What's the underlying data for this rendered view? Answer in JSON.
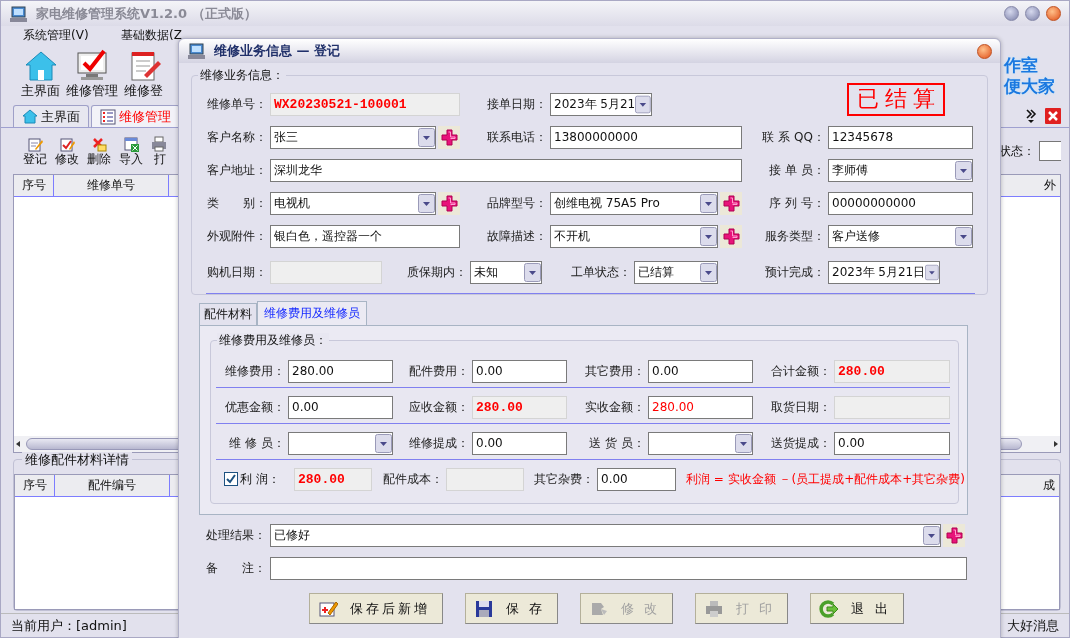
{
  "app": {
    "title": "家电维修管理系统V1.2.0 （正式版）",
    "menu": [
      "系统管理(V)",
      "基础数据(Z"
    ],
    "toolbar": [
      "主界面",
      "维修管理",
      "维修登"
    ],
    "banner": [
      "作室",
      "便大家"
    ],
    "tabs": [
      {
        "label": "主界面",
        "selected": false
      },
      {
        "label": "维修管理",
        "selected": true
      }
    ],
    "actions": [
      "登记",
      "修改",
      "删除",
      "导入",
      "打"
    ],
    "status_filter": {
      "label": "状态："
    },
    "orders_table": {
      "columns": [
        "序号",
        "维修单号",
        "外"
      ]
    },
    "parts_panel": {
      "title": "维修配件材料详情",
      "columns": [
        "序号",
        "配件编号",
        "成"
      ]
    },
    "status_bar": {
      "user": "当前用户：[admin]",
      "message": "大好消息"
    }
  },
  "dialog": {
    "title": "维修业务信息 — 登记",
    "info": {
      "title": "维修业务信息：",
      "stamp": "已结算",
      "fields": [
        {
          "label": "维修单号：",
          "kind": "amount",
          "value": "WX20230521-100001"
        },
        {
          "label": "接单日期：",
          "kind": "date",
          "value": "2023年 5月21"
        },
        {
          "label": "客户名称：",
          "kind": "combo",
          "value": "张三",
          "plus": true
        },
        {
          "label": "联系电话：",
          "kind": "text",
          "value": "13800000000"
        },
        {
          "label": "联 系 QQ：",
          "kind": "text",
          "value": "12345678"
        },
        {
          "label": "客户地址：",
          "kind": "text",
          "value": "深圳龙华"
        },
        {
          "label": "接 单 员：",
          "kind": "combo",
          "value": "李师傅"
        },
        {
          "label": "类　　别：",
          "kind": "combo",
          "value": "电视机",
          "plus": true
        },
        {
          "label": "品牌型号：",
          "kind": "combo",
          "value": "创维电视 75A5 Pro",
          "plus": true
        },
        {
          "label": "序 列 号：",
          "kind": "text",
          "value": "00000000000"
        },
        {
          "label": "外观附件：",
          "kind": "text",
          "value": "银白色，遥控器一个"
        },
        {
          "label": "故障描述：",
          "kind": "combo",
          "value": "不开机",
          "plus": true
        },
        {
          "label": "服务类型：",
          "kind": "combo",
          "value": "客户送修"
        },
        {
          "label": "购机日期：",
          "kind": "readonly"
        },
        {
          "label": "质保期内：",
          "kind": "combo",
          "value": "未知"
        },
        {
          "label": "工单状态：",
          "kind": "combo",
          "value": "已结算"
        },
        {
          "label": "预计完成：",
          "kind": "date",
          "value": "2023年 5月21日"
        }
      ]
    },
    "tabs": [
      {
        "label": "配件材料",
        "selected": false
      },
      {
        "label": "维修费用及维修员",
        "selected": true
      }
    ],
    "fees": {
      "title": "维修费用及维修员：",
      "rows": [
        [
          {
            "label": "维修费用：",
            "kind": "text",
            "value": "280.00"
          },
          {
            "label": "配件费用：",
            "kind": "text",
            "value": "0.00"
          },
          {
            "label": "其它费用：",
            "kind": "text",
            "value": "0.00"
          },
          {
            "label": "合计金额：",
            "kind": "amount",
            "value": "280.00"
          }
        ],
        [
          {
            "label": "优惠金额：",
            "kind": "text",
            "value": "0.00"
          },
          {
            "label": "应收金额：",
            "kind": "amount",
            "value": "280.00"
          },
          {
            "label": "实收金额：",
            "kind": "received",
            "value": "280.00"
          },
          {
            "label": "取货日期：",
            "kind": "readonly"
          }
        ],
        [
          {
            "label": "维 修 员：",
            "kind": "combo"
          },
          {
            "label": "维修提成：",
            "kind": "text",
            "value": "0.00"
          },
          {
            "label": "送 货 员：",
            "kind": "combo"
          },
          {
            "label": "送货提成：",
            "kind": "text",
            "value": "0.00"
          }
        ]
      ],
      "profit": {
        "label": "利 润：",
        "checked": true,
        "value": "280.00",
        "fields": [
          {
            "label": "配件成本：",
            "kind": "readonly"
          },
          {
            "label": "其它杂费：",
            "kind": "text",
            "value": "0.00"
          }
        ],
        "formula": "利润 = 实收金额 －(员工提成+配件成本+其它杂费)"
      }
    },
    "bottom": [
      {
        "label": "处理结果：",
        "kind": "combo",
        "value": "已修好",
        "plus": true
      },
      {
        "label": "备　　注：",
        "kind": "text"
      }
    ],
    "buttons": [
      {
        "label": "保存后新增",
        "disabled": false
      },
      {
        "label": "保 存",
        "disabled": false
      },
      {
        "label": "修 改",
        "disabled": true
      },
      {
        "label": "打 印",
        "disabled": true
      },
      {
        "label": "退 出",
        "disabled": false
      }
    ]
  }
}
